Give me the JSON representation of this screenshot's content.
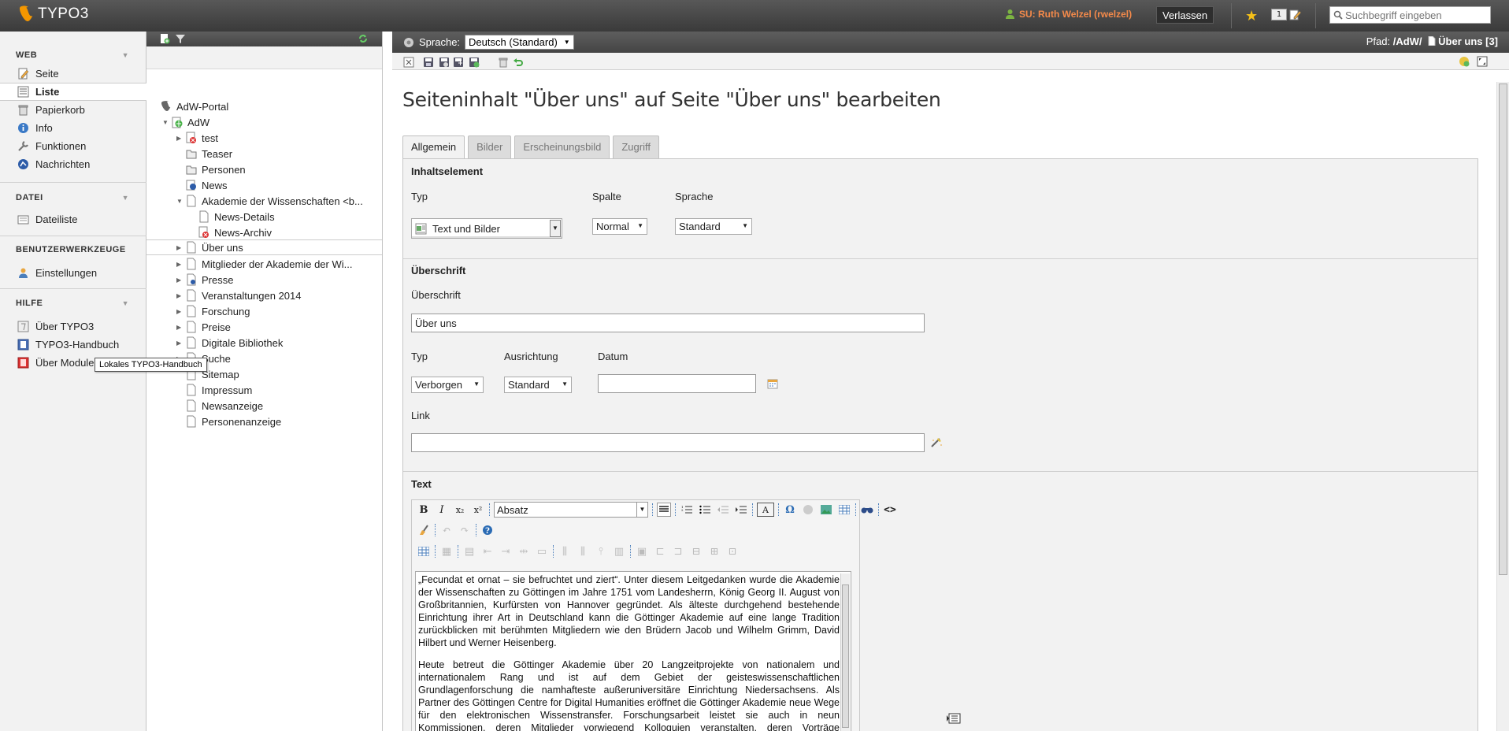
{
  "app": {
    "logo_text": "TYPO3"
  },
  "topbar": {
    "user_label": "SU: Ruth Welzel (rwelzel)",
    "leave_label": "Verlassen",
    "workspace_count": "1",
    "search_placeholder": "Suchbegriff eingeben"
  },
  "modules": {
    "web": {
      "title": "WEB",
      "items": [
        "Seite",
        "Liste",
        "Papierkorb",
        "Info",
        "Funktionen",
        "Nachrichten"
      ]
    },
    "datei": {
      "title": "DATEI",
      "items": [
        "Dateiliste"
      ]
    },
    "tools": {
      "title": "BENUTZERWERKZEUGE",
      "items": [
        "Einstellungen"
      ]
    },
    "hilfe": {
      "title": "HILFE",
      "items": [
        "Über TYPO3",
        "TYPO3-Handbuch",
        "Über Module"
      ]
    },
    "active_item": "Liste",
    "tooltip": "Lokales TYPO3-Handbuch"
  },
  "tree": {
    "root": "AdW-Portal",
    "site": "AdW",
    "children": [
      "test",
      "Teaser",
      "Personen",
      "News",
      "Akademie der Wissenschaften <b...",
      "News-Details",
      "News-Archiv",
      "Über uns",
      "Mitglieder der Akademie der Wi...",
      "Presse",
      "Veranstaltungen 2014",
      "Forschung",
      "Preise",
      "Digitale Bibliothek",
      "Suche",
      "Sitemap",
      "Impressum",
      "Newsanzeige",
      "Personenanzeige"
    ],
    "selected": "Über uns"
  },
  "docheader": {
    "language_label": "Sprache:",
    "language_value": "Deutsch (Standard)",
    "path_label": "Pfad:",
    "path_value": "/AdW/",
    "page_label": "Über uns [3]"
  },
  "page_title": "Seiteninhalt \"Über uns\" auf Seite \"Über uns\" bearbeiten",
  "tabs": [
    "Allgemein",
    "Bilder",
    "Erscheinungsbild",
    "Zugriff"
  ],
  "form": {
    "content_element": {
      "title": "Inhaltselement",
      "type_label": "Typ",
      "type_value": "Text und Bilder",
      "column_label": "Spalte",
      "column_value": "Normal",
      "language_label": "Sprache",
      "language_value": "Standard"
    },
    "heading": {
      "title": "Überschrift",
      "heading_label": "Überschrift",
      "heading_value": "Über uns",
      "type_label": "Typ",
      "type_value": "Verborgen",
      "align_label": "Ausrichtung",
      "align_value": "Standard",
      "date_label": "Datum",
      "date_value": "",
      "link_label": "Link",
      "link_value": ""
    },
    "text": {
      "title": "Text",
      "format_value": "Absatz",
      "paragraph1": "„Fecundat et ornat – sie befruchtet und ziert“. Unter diesem Leitgedanken wurde die Akademie der Wissenschaften zu Göttingen im Jahre 1751 vom Landesherrn, König Georg II. August von Großbritannien, Kurfürsten von Hannover gegründet. Als älteste durchgehend bestehende Einrichtung ihrer Art in Deutschland kann die Göttinger Akademie auf eine lange Tradition zurückblicken mit berühmten Mitgliedern wie den Brüdern Jacob und Wilhelm Grimm, David Hilbert und Werner Heisenberg.",
      "paragraph2": "Heute betreut die Göttinger Akademie über 20 Langzeitprojekte von nationalem und internationalem Rang und ist auf dem Gebiet der geisteswissenschaftlichen Grundlagenforschung die namhafteste außeruniversitäre Einrichtung Niedersachsens. Als Partner des Göttingen Centre for Digital Humanities eröffnet die Göttinger Akademie neue Wege für den elektronischen Wissenstransfer. Forschungsarbeit leistet sie auch in neun Kommissionen, deren Mitglieder vorwiegend Kolloquien veranstalten, deren Vorträge veröffentlicht werden."
    }
  },
  "colors": {
    "accent_orange": "#f49700",
    "user_orange": "#f58a4a",
    "link_blue": "#2a6bb4"
  }
}
